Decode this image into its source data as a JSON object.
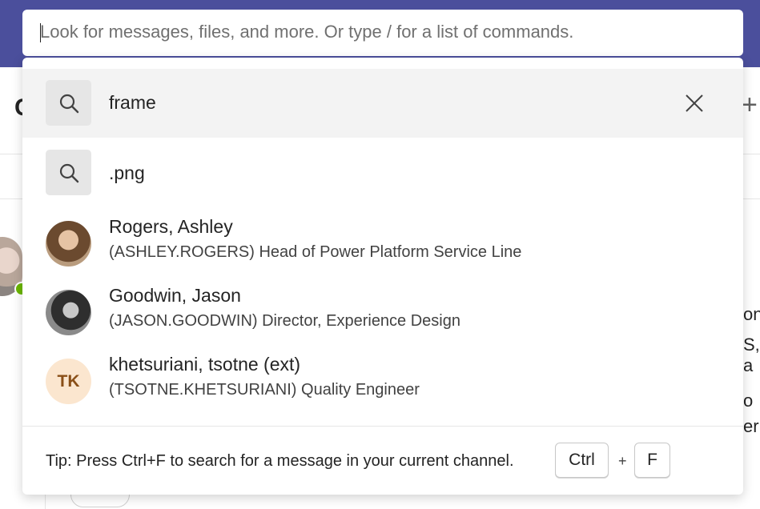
{
  "background": {
    "partial_letter": "C",
    "plus_glyph": "+",
    "frag1": "on",
    "frag2": "S, a",
    "frag3": "o",
    "frag4": "er"
  },
  "search": {
    "placeholder": "Look for messages, files, and more. Or type / for a list of commands.",
    "query": "frame"
  },
  "suggestions": [
    {
      "type": "search",
      "label": ".png"
    },
    {
      "type": "person",
      "name": "Rogers, Ashley",
      "detail": "(ASHLEY.ROGERS) Head of Power Platform Service Line"
    },
    {
      "type": "person",
      "name": "Goodwin, Jason",
      "detail": "(JASON.GOODWIN) Director, Experience Design"
    },
    {
      "type": "person",
      "name": "khetsuriani, tsotne (ext)",
      "detail": "(TSOTNE.KHETSURIANI) Quality Engineer",
      "initials": "TK"
    }
  ],
  "tip": {
    "text": "Tip: Press Ctrl+F to search for a message in your current channel.",
    "key1": "Ctrl",
    "plus": "+",
    "key2": "F"
  },
  "colors": {
    "topbar": "#4b4f9c",
    "initials_bg": "#fbe6cf",
    "initials_fg": "#8a4f17",
    "presence": "#6bb700"
  },
  "icons": [
    "search-icon",
    "close-icon"
  ]
}
